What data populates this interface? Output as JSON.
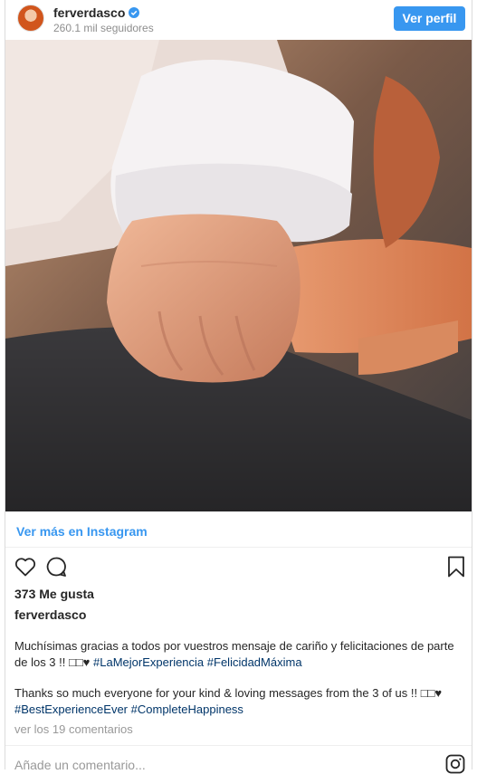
{
  "header": {
    "username": "ferverdasco",
    "followers": "260.1 mil seguidores",
    "view_profile": "Ver perfil"
  },
  "post": {
    "see_more": "Ver más en Instagram",
    "likes": "373 Me gusta",
    "author": "ferverdasco",
    "caption_es_text": "Muchísimas gracias a todos por vuestros mensaje de cariño y felicitaciones de parte de los 3 !! □□♥",
    "caption_es_tags": [
      "#LaMejorExperiencia",
      "#FelicidadMáxima"
    ],
    "caption_en_text": "Thanks so much everyone for your kind & loving messages from the 3 of us !! □□♥",
    "caption_en_tags": [
      "#BestExperienceEver",
      "#CompleteHappiness"
    ],
    "view_comments": "ver los 19 comentarios",
    "add_comment": "Añade un comentario..."
  },
  "icons": [
    "heart-icon",
    "comment-icon",
    "bookmark-icon",
    "instagram-icon",
    "verified-icon"
  ],
  "colors": {
    "accent": "#3897f0",
    "hashtag": "#003569",
    "muted": "#8e8e8e"
  }
}
